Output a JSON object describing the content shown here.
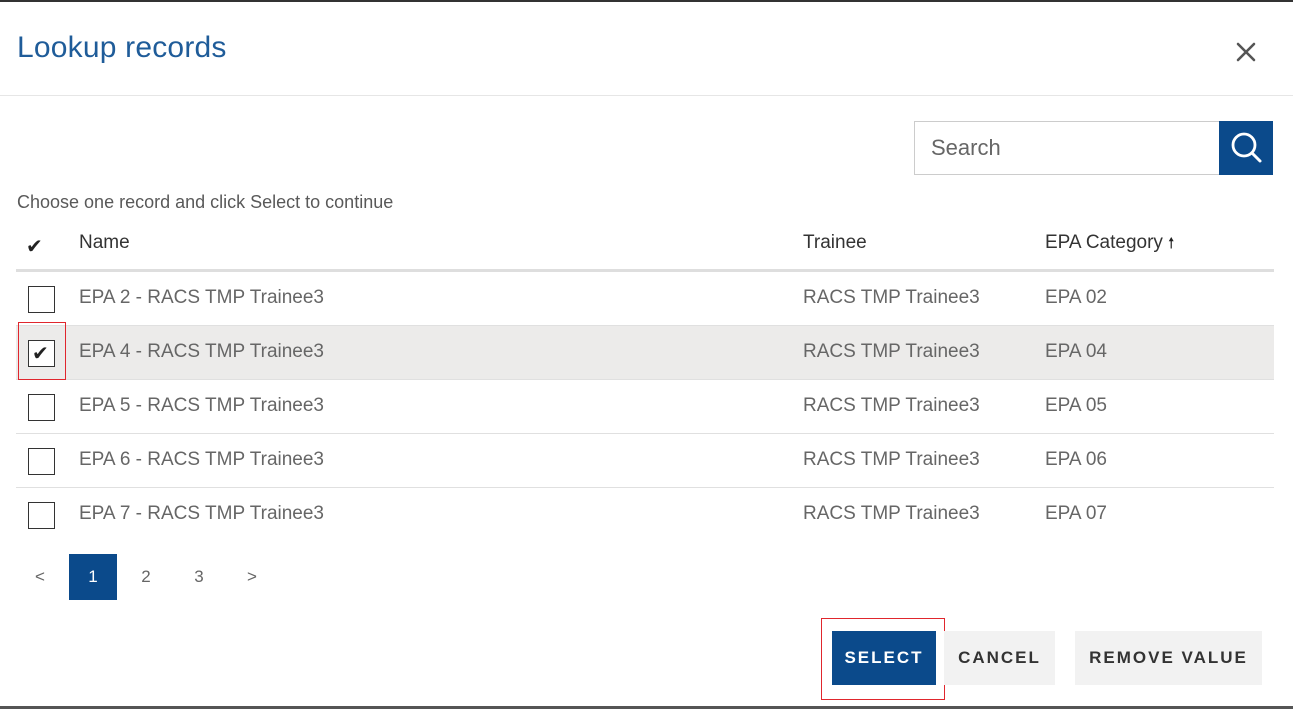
{
  "dialog": {
    "title": "Lookup records",
    "close_icon": "close-icon"
  },
  "search": {
    "placeholder": "Search",
    "value": "",
    "icon": "search-icon"
  },
  "instruction": "Choose one record and click Select to continue",
  "grid": {
    "columns": {
      "check": "✔",
      "name": "Name",
      "trainee": "Trainee",
      "epa_category": "EPA Category",
      "sort_indicator": "🠕"
    },
    "rows": [
      {
        "name": "EPA 2 - RACS TMP Trainee3",
        "trainee": "RACS TMP Trainee3",
        "epa_category": "EPA 02",
        "checked": false
      },
      {
        "name": "EPA 4 - RACS TMP Trainee3",
        "trainee": "RACS TMP Trainee3",
        "epa_category": "EPA 04",
        "checked": true
      },
      {
        "name": "EPA 5 - RACS TMP Trainee3",
        "trainee": "RACS TMP Trainee3",
        "epa_category": "EPA 05",
        "checked": false
      },
      {
        "name": "EPA 6 - RACS TMP Trainee3",
        "trainee": "RACS TMP Trainee3",
        "epa_category": "EPA 06",
        "checked": false
      },
      {
        "name": "EPA 7 - RACS TMP Trainee3",
        "trainee": "RACS TMP Trainee3",
        "epa_category": "EPA 07",
        "checked": false
      }
    ],
    "check_mark": "✔"
  },
  "pagination": {
    "prev": "<",
    "pages": [
      "1",
      "2",
      "3"
    ],
    "current": "1",
    "next": ">"
  },
  "actions": {
    "select": "SELECT",
    "cancel": "CANCEL",
    "remove": "REMOVE VALUE"
  },
  "colors": {
    "primary": "#0b4a8b",
    "title": "#1f5c99",
    "highlight": "#e0262d",
    "selected_row": "#ecebea"
  }
}
